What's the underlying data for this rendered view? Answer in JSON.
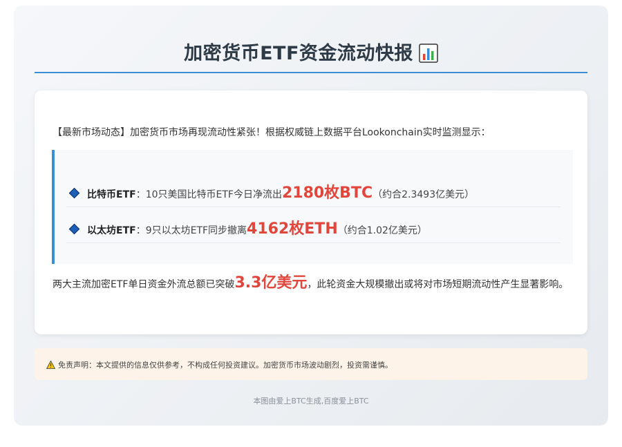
{
  "header": {
    "title": "加密货币ETF资金流动快报",
    "title_icon": "bar-chart-icon"
  },
  "intro": "【最新市场动态】加密货币市场再现流动性紧张！根据权威链上数据平台Lookonchain实时监测显示：",
  "items": [
    {
      "label": "比特币ETF",
      "sep": "：",
      "text": "10只美国比特币ETF今日净流出",
      "highlight": "2180枚BTC",
      "note": "（约合2.3493亿美元）"
    },
    {
      "label": "以太坊ETF",
      "sep": "：",
      "text": "9只以太坊ETF同步撤离",
      "highlight": "4162枚ETH",
      "note": "（约合1.02亿美元）"
    }
  ],
  "summary": {
    "before": "两大主流加密ETF单日资金外流总额已突破",
    "highlight": "3.3亿美元",
    "after": "，此轮资金大规模撤出或将对市场短期流动性产生显著影响。"
  },
  "disclaimer": {
    "icon": "warning-icon",
    "text": "免责声明：本文提供的信息仅供参考，不构成任何投资建议。加密货币市场波动剧烈，投资需谨慎。"
  },
  "footer": "本图由爱上BTC生成,百度爱上BTC",
  "colors": {
    "accent": "#3b8ed3",
    "highlight": "#e0463b",
    "diamond": "#1d5fb6",
    "disclaimer_bg": "#fdf3e8"
  }
}
